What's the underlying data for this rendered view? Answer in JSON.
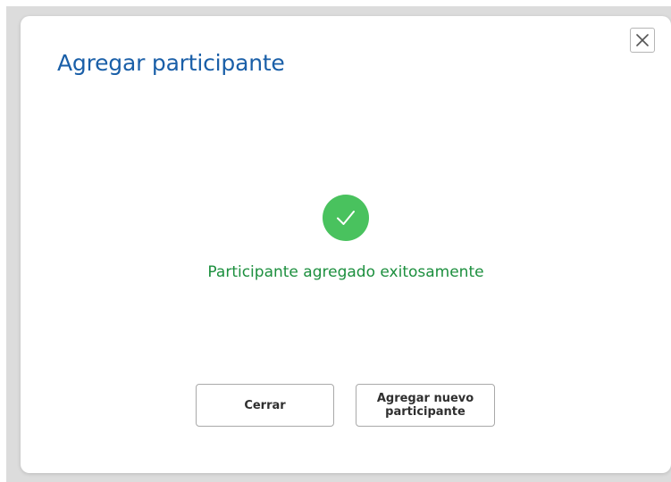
{
  "dialog": {
    "title": "Agregar participante",
    "close_icon": "close-icon",
    "success_icon": "checkmark-circle-icon",
    "success_message": "Participante agregado exitosamente",
    "buttons": {
      "close_label": "Cerrar",
      "add_new_label": "Agregar nuevo participante"
    }
  },
  "colors": {
    "title": "#1a5fa8",
    "success": "#49c25e",
    "success_text": "#1c8f3e",
    "backdrop": "#dcdcdc"
  }
}
